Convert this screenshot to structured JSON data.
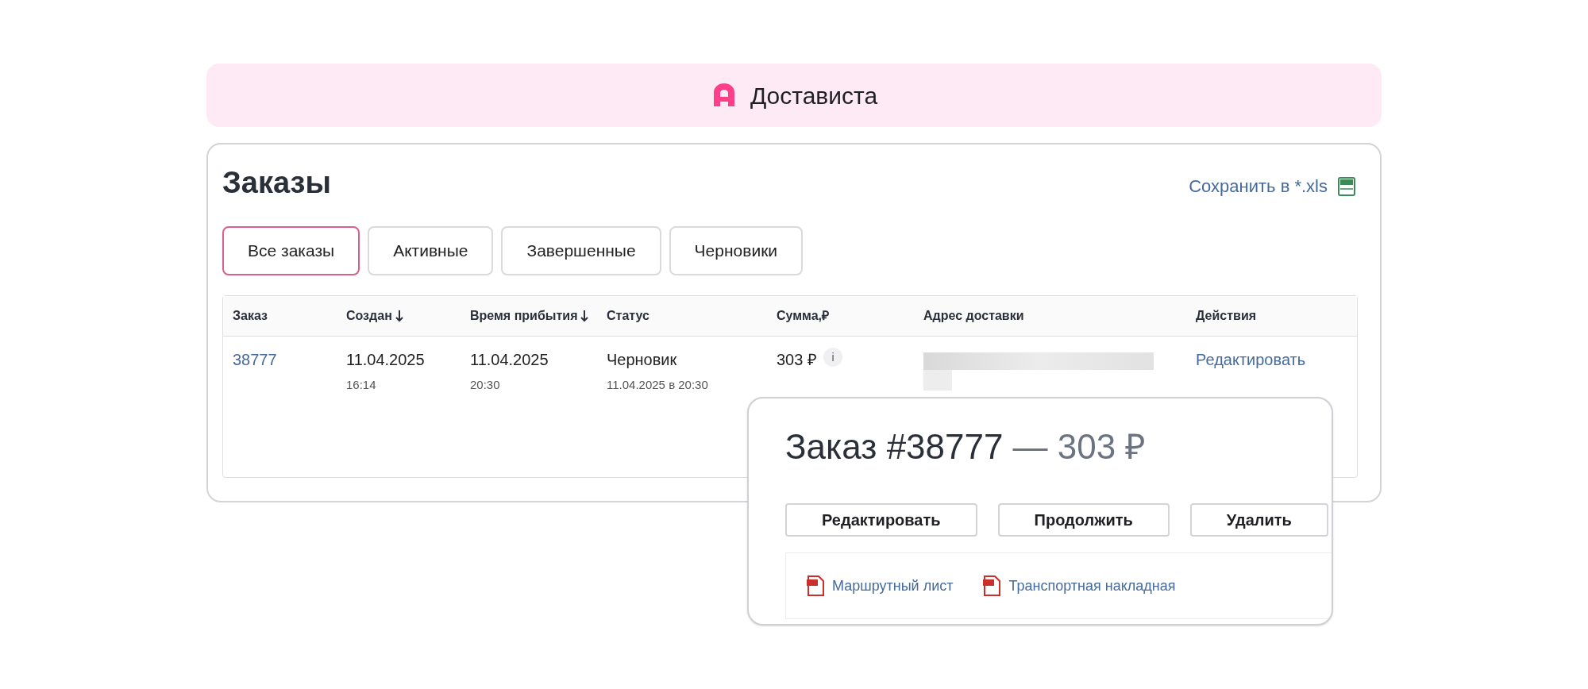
{
  "header": {
    "brand": "Достависта"
  },
  "page": {
    "title": "Заказы",
    "export_link": "Сохранить в *.xls"
  },
  "tabs": [
    {
      "label": "Все заказы",
      "selected": true
    },
    {
      "label": "Активные",
      "selected": false
    },
    {
      "label": "Завершенные",
      "selected": false
    },
    {
      "label": "Черновики",
      "selected": false
    }
  ],
  "table": {
    "columns": [
      {
        "label": "Заказ",
        "sorted": false
      },
      {
        "label": "Создан",
        "sorted": true
      },
      {
        "label": "Время прибытия",
        "sorted": true
      },
      {
        "label": "Статус",
        "sorted": false
      },
      {
        "label": "Сумма,₽",
        "sorted": false
      },
      {
        "label": "Адрес доставки",
        "sorted": false
      },
      {
        "label": "Действия",
        "sorted": false
      }
    ],
    "rows": [
      {
        "order": "38777",
        "created_date": "11.04.2025",
        "created_time": "16:14",
        "arrival_date": "11.04.2025",
        "arrival_time": "20:30",
        "status": "Черновик",
        "status_detail": "11.04.2025 в 20:30",
        "sum": "303 ₽",
        "sum_info": "i",
        "action": "Редактировать"
      }
    ]
  },
  "popup": {
    "title": "Заказ #38777",
    "amount": "— 303 ₽",
    "buttons": [
      "Редактировать",
      "Продолжить",
      "Удалить"
    ],
    "documents": [
      "Маршрутный лист",
      "Транспортная накладная"
    ]
  }
}
